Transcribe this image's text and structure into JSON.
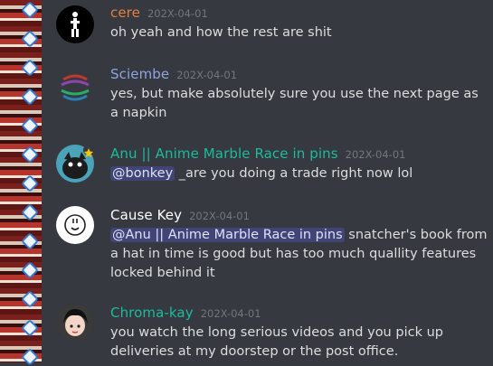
{
  "colors": {
    "background": "#36393f",
    "text": "#dcddde",
    "timestamp": "#72767d",
    "mention_bg": "#4e5287",
    "mention_text": "#dee0fc"
  },
  "messages": [
    {
      "username": "cere",
      "name_color": "#e67e3c",
      "timestamp": "202X-04-01",
      "avatar": "stick-figure-avatar",
      "text": "oh yeah and how the rest are shit"
    },
    {
      "username": "Sciembe",
      "name_color": "#8ea4e0",
      "timestamp": "202X-04-01",
      "avatar": "striped-globe-avatar",
      "text": "yes, but make absolutely sure you use the next page as a napkin"
    },
    {
      "username": "Anu || Anime Marble Race in pins",
      "name_color": "#1abc9c",
      "timestamp": "202X-04-01",
      "avatar": "dark-creature-avatar",
      "mention": "@bonkey",
      "text": " _are you doing a trade right now lol"
    },
    {
      "username": "Cause Key",
      "name_color": "#ffffff",
      "timestamp": "202X-04-01",
      "avatar": "white-face-avatar",
      "mention": "@Anu || Anime Marble Race in pins",
      "text": " snatcher's book from a hat in time is good but has too much quallity features locked behind it"
    },
    {
      "username": "Chroma-kay",
      "name_color": "#1abc9c",
      "timestamp": "202X-04-01",
      "avatar": "anime-girl-avatar",
      "text": "you watch the long serious videos and you pick up deliveries at my doorstep or the post office."
    }
  ]
}
